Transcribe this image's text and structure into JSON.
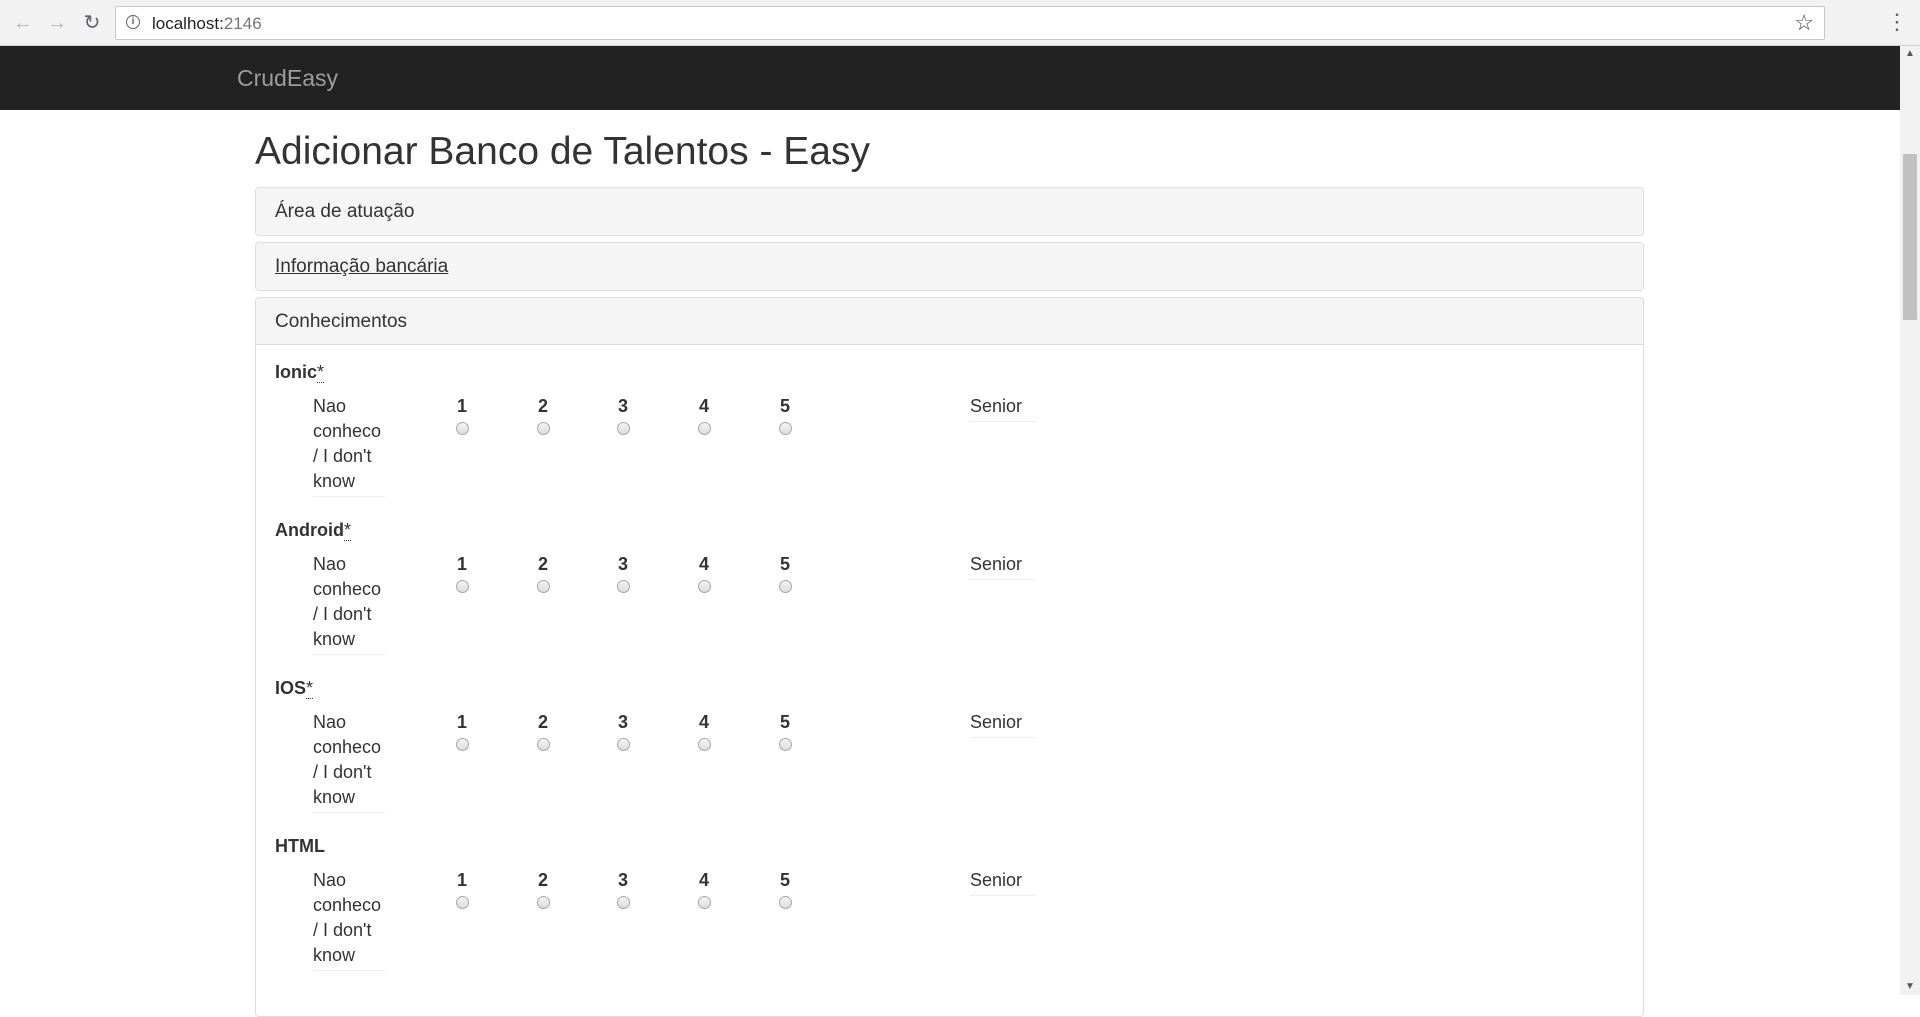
{
  "browser": {
    "url_host": "localhost:",
    "url_port": "2146"
  },
  "navbar": {
    "brand": "CrudEasy"
  },
  "page": {
    "title": "Adicionar Banco de Talentos - Easy",
    "panels": [
      {
        "label": "Área de atuação"
      },
      {
        "label": "Informação bancária"
      },
      {
        "label": "Conhecimentos"
      }
    ]
  },
  "skills": [
    {
      "name": "Ionic",
      "required": "*"
    },
    {
      "name": "Android",
      "required": "*"
    },
    {
      "name": "IOS",
      "required": "*"
    },
    {
      "name": "HTML",
      "required": ""
    }
  ],
  "scale": {
    "low_label": "Nao conheco / I don't know",
    "high_label": "Senior",
    "options": [
      "1",
      "2",
      "3",
      "4",
      "5"
    ]
  },
  "icons": {
    "back": "back-arrow-icon",
    "forward": "forward-arrow-icon",
    "reload": "reload-icon",
    "info": "info-icon",
    "star": "star-icon",
    "menu": "vertical-dots-icon"
  }
}
